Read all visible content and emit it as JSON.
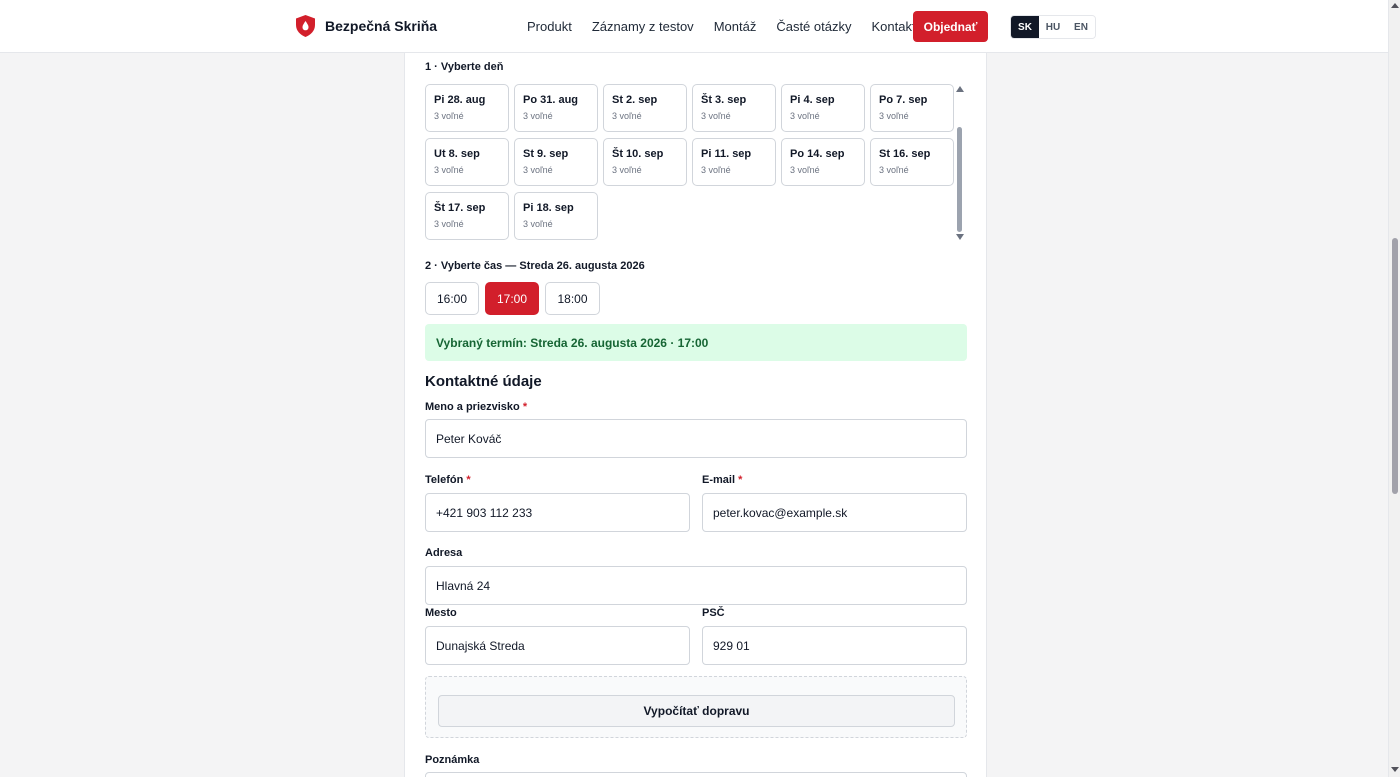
{
  "header": {
    "brand": "Bezpečná Skriňa",
    "nav": [
      "Produkt",
      "Záznamy z testov",
      "Montáž",
      "Časté otázky",
      "Kontakt"
    ],
    "order_button": "Objednať",
    "languages": [
      {
        "code": "SK",
        "active": true
      },
      {
        "code": "HU",
        "active": false
      },
      {
        "code": "EN",
        "active": false
      }
    ]
  },
  "booking": {
    "step1_label": "1 · Vyberte deň",
    "days": [
      {
        "label": "Pi 28. aug",
        "slots": "3 voľné"
      },
      {
        "label": "Po 31. aug",
        "slots": "3 voľné"
      },
      {
        "label": "St 2. sep",
        "slots": "3 voľné"
      },
      {
        "label": "Št 3. sep",
        "slots": "3 voľné"
      },
      {
        "label": "Pi 4. sep",
        "slots": "3 voľné"
      },
      {
        "label": "Po 7. sep",
        "slots": "3 voľné"
      },
      {
        "label": "Ut 8. sep",
        "slots": "3 voľné"
      },
      {
        "label": "St 9. sep",
        "slots": "3 voľné"
      },
      {
        "label": "Št 10. sep",
        "slots": "3 voľné"
      },
      {
        "label": "Pi 11. sep",
        "slots": "3 voľné"
      },
      {
        "label": "Po 14. sep",
        "slots": "3 voľné"
      },
      {
        "label": "St 16. sep",
        "slots": "3 voľné"
      },
      {
        "label": "Št 17. sep",
        "slots": "3 voľné"
      },
      {
        "label": "Pi 18. sep",
        "slots": "3 voľné"
      }
    ],
    "step2_label": "2 · Vyberte čas — Streda 26. augusta 2026",
    "times": [
      {
        "label": "16:00",
        "selected": false
      },
      {
        "label": "17:00",
        "selected": true
      },
      {
        "label": "18:00",
        "selected": false
      }
    ],
    "selected_text": "Vybraný termín: Streda 26. augusta 2026 · 17:00"
  },
  "contact": {
    "title": "Kontaktné údaje",
    "name_label": "Meno a priezvisko",
    "name_value": "Peter Kováč",
    "phone_label": "Telefón",
    "phone_value": "+421 903 112 233",
    "email_label": "E-mail",
    "email_value": "peter.kovac@example.sk",
    "address_label": "Adresa",
    "address_value": "Hlavná 24",
    "city_label": "Mesto",
    "city_value": "Dunajská Streda",
    "zip_label": "PSČ",
    "zip_value": "929 01",
    "required_mark": "*",
    "calc_shipping_button": "Vypočítať dopravu",
    "note_label": "Poznámka"
  },
  "colors": {
    "accent": "#d21f2b",
    "success_bg": "#dcfce7",
    "success_text": "#166534"
  },
  "icons": {
    "brand": "shield-drop-icon"
  }
}
